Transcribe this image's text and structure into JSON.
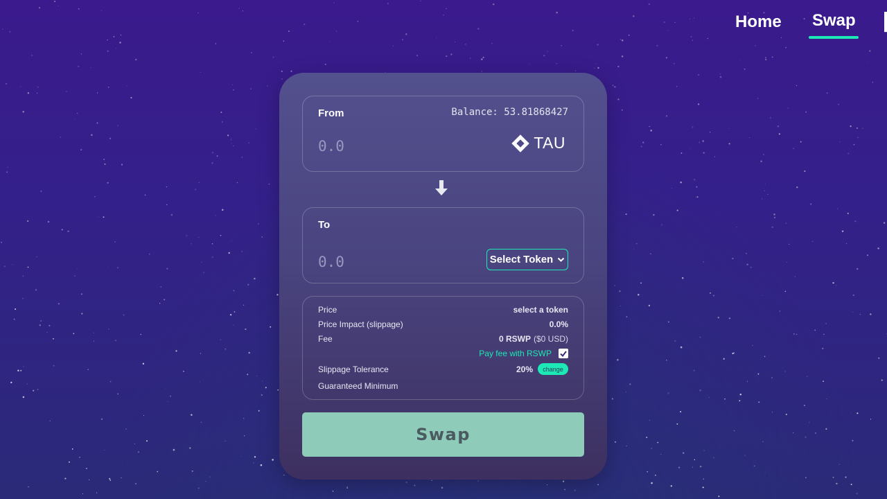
{
  "nav": {
    "items": [
      {
        "label": "Home",
        "active": false
      },
      {
        "label": "Swap",
        "active": true
      }
    ],
    "accent_color": "#1de9b6"
  },
  "from": {
    "label": "From",
    "balance_text": "Balance: 53.81868427",
    "amount_placeholder": "0.0",
    "token_icon": "lamden-diamond-icon",
    "token_symbol": "TAU"
  },
  "swap_direction_icon": "arrow-down-icon",
  "to": {
    "label": "To",
    "amount_placeholder": "0.0",
    "select_token_label": "Select Token",
    "select_icon": "chevron-down-icon"
  },
  "info": {
    "price_label": "Price",
    "price_value": "select a token",
    "impact_label": "Price Impact (slippage)",
    "impact_value": "0.0%",
    "fee_label": "Fee",
    "fee_value": "0 RSWP",
    "fee_usd": "($0 USD)",
    "pay_fee_label": "Pay fee with RSWP",
    "pay_fee_checked": true,
    "slippage_label": "Slippage Tolerance",
    "slippage_value": "20%",
    "change_label": "change",
    "guaranteed_label": "Guaranteed Minimum"
  },
  "swap_button_label": "Swap",
  "colors": {
    "accent": "#1de9b6",
    "swap_button": "#8ecbb8",
    "background": "#34208a"
  }
}
